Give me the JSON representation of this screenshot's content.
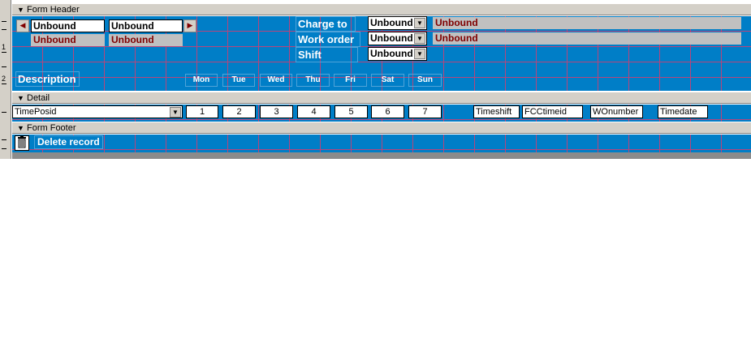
{
  "ruler": {
    "marks": [
      "1",
      "2"
    ]
  },
  "sections": {
    "header": "Form Header",
    "detail": "Detail",
    "footer": "Form Footer"
  },
  "header": {
    "nav_box1": "Unbound",
    "nav_box2": "Unbound",
    "gray_box1": "Unbound",
    "gray_box2": "Unbound",
    "charge_to_label": "Charge to",
    "work_order_label": "Work order",
    "shift_label": "Shift",
    "charge_combo": "Unbound",
    "work_combo": "Unbound",
    "shift_combo": "Unbound",
    "charge_desc": "Unbound",
    "work_desc": "Unbound",
    "description_label": "Description",
    "days": [
      "Mon",
      "Tue",
      "Wed",
      "Thu",
      "Fri",
      "Sat",
      "Sun"
    ]
  },
  "detail": {
    "timeposid": "TimePosid",
    "day_values": [
      "1",
      "2",
      "3",
      "4",
      "5",
      "6",
      "7"
    ],
    "timeshift": "Timeshift",
    "fcctimeid": "FCCtimeid",
    "wonumber": "WOnumber",
    "timedate": "Timedate"
  },
  "footer": {
    "delete_label": "Delete record"
  },
  "colors": {
    "surface": "#007ec7",
    "grid": "#b8457b",
    "unbound_text": "#800000"
  }
}
